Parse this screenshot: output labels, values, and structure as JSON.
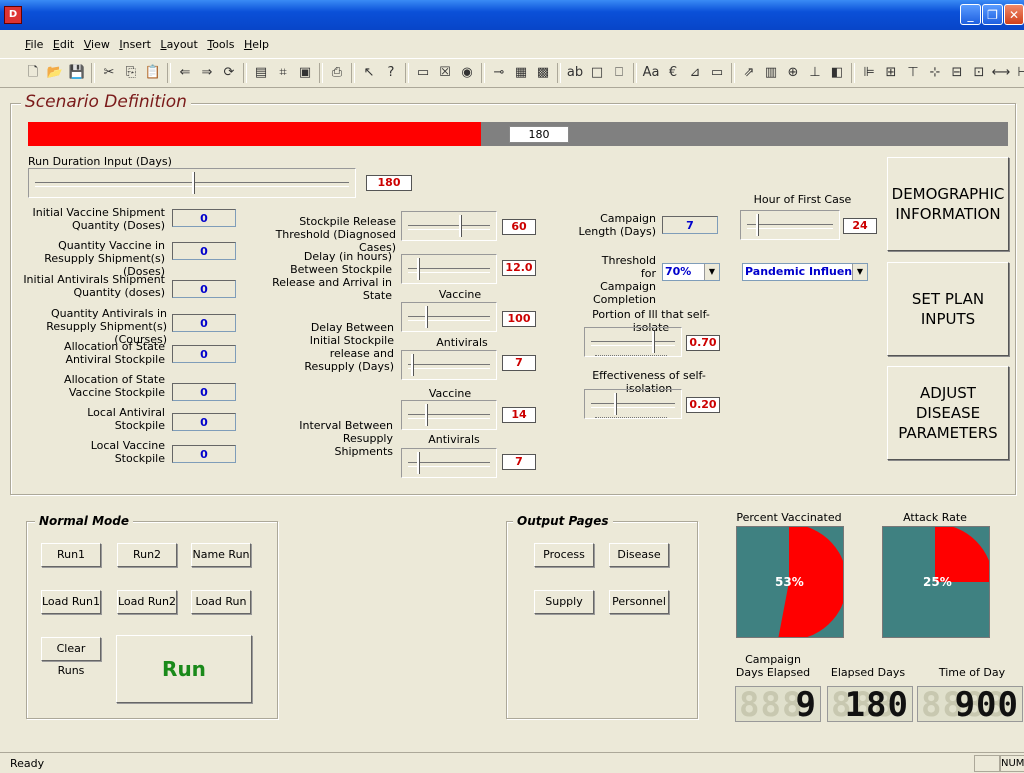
{
  "window": {
    "app_icon": "D",
    "minimize": "_",
    "restore": "❐",
    "close": "✕"
  },
  "menu": [
    "File",
    "Edit",
    "View",
    "Insert",
    "Layout",
    "Tools",
    "Help"
  ],
  "scenario": {
    "title": "Scenario Definition",
    "progress_value": "180",
    "progress_fraction": 0.462,
    "run_duration_label": "Run Duration Input (Days)",
    "run_duration_value": "180",
    "fields": [
      {
        "label": "Initial Vaccine Shipment Quantity (Doses)",
        "value": "0"
      },
      {
        "label": "Quantity Vaccine in Resupply Shipment(s) (Doses)",
        "value": "0"
      },
      {
        "label": "Initial Antivirals Shipment Quantity (doses)",
        "value": "0"
      },
      {
        "label": "Quantity Antivirals in Resupply Shipment(s) (Courses)",
        "value": "0"
      },
      {
        "label": "Allocation of State Antiviral Stockpile",
        "value": "0"
      },
      {
        "label": "Allocation of State Vaccine Stockpile",
        "value": "0"
      },
      {
        "label": "Local Antiviral Stockpile",
        "value": "0"
      },
      {
        "label": "Local Vaccine Stockpile",
        "value": "0"
      }
    ],
    "stockpile_release_label": "Stockpile Release Threshold (Diagnosed Cases)",
    "stockpile_release_value": "60",
    "delay_arrival_label": "Delay (in hours) Between Stockpile Release and Arrival in State",
    "delay_arrival_value": "12.0",
    "delay_resupply_label": "Delay Between Initial Stockpile release and Resupply (Days)",
    "vaccine_label": "Vaccine",
    "antivirals_label": "Antivirals",
    "delay_resupply_vaccine_value": "100",
    "delay_resupply_antivirals_value": "7",
    "interval_label": "Interval Between Resupply Shipments",
    "interval_vaccine_value": "14",
    "interval_antivirals_value": "7",
    "campaign_length_label": "Campaign Length (Days)",
    "campaign_length_value": "7",
    "threshold_label": "Threshold for Campaign Completion",
    "threshold_value": "70%",
    "hour_first_case_label": "Hour of First Case",
    "hour_first_case_value": "24",
    "disease_select": "Pandemic Influenz",
    "self_isolate_label": "Portion of Ill that self-isolate",
    "self_isolate_value": "0.70",
    "effectiveness_label": "Effectiveness of self-isolation",
    "effectiveness_value": "0.20",
    "demographic_button": "DEMOGRAPHIC INFORMATION",
    "set_plan_button": "SET PLAN INPUTS",
    "adjust_disease_button": "ADJUST DISEASE PARAMETERS"
  },
  "normal_mode": {
    "title": "Normal Mode",
    "run1": "Run1",
    "run2": "Run2",
    "name_run": "Name Run",
    "load_run1": "Load Run1",
    "load_run2": "Load Run2",
    "load_run": "Load Run",
    "clear_runs": "Clear Runs",
    "run": "Run"
  },
  "output_pages": {
    "title": "Output Pages",
    "process": "Process",
    "disease": "Disease",
    "supply": "Supply",
    "personnel": "Personnel"
  },
  "charts": {
    "percent_vaccinated": {
      "label": "Percent Vaccinated",
      "value": 53,
      "text": "53%"
    },
    "attack_rate": {
      "label": "Attack Rate",
      "value": 25,
      "text": "25%"
    }
  },
  "counters": {
    "campaign_days_label": "Campaign Days Elapsed",
    "campaign_days_value": "9",
    "elapsed_days_label": "Elapsed Days",
    "elapsed_days_value": "180",
    "time_of_day_label": "Time of Day",
    "time_of_day_value": "900"
  },
  "status": {
    "text": "Ready",
    "num": "NUM"
  },
  "colors": {
    "accent_red": "#ff0000",
    "pie_bg": "#3f8181",
    "value_blue": "#0000cc",
    "value_red": "#cc0000",
    "run_green": "#1a8a1a"
  }
}
